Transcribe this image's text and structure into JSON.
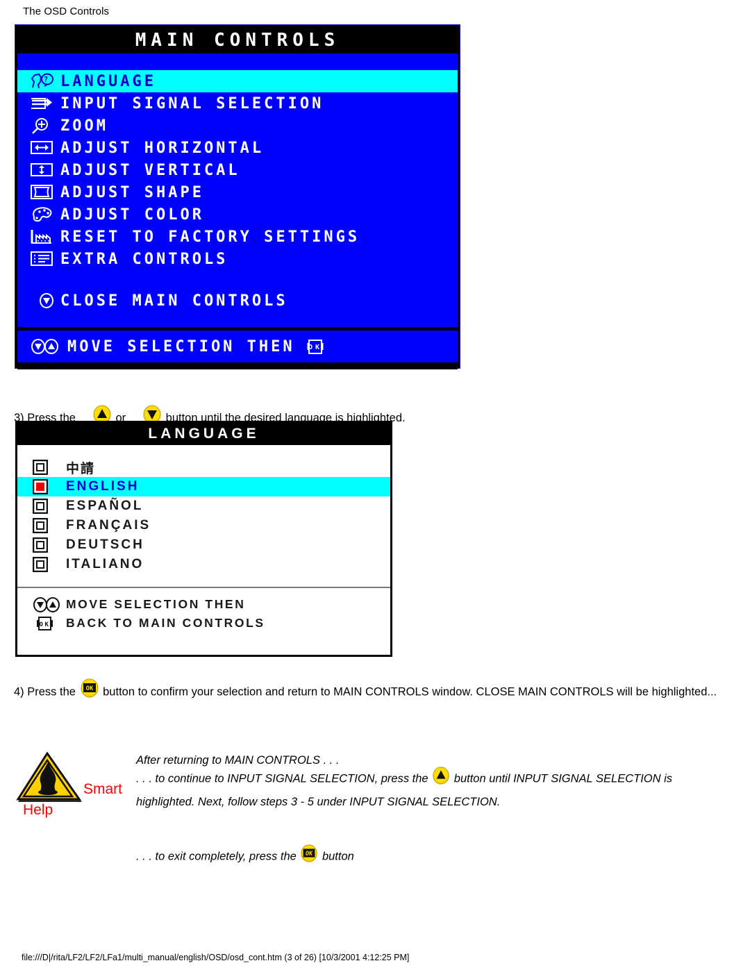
{
  "page_header": "The OSD Controls",
  "main_controls": {
    "title": "MAIN CONTROLS",
    "items": [
      {
        "icon": "language-face-icon",
        "label": "LANGUAGE",
        "highlighted": true
      },
      {
        "icon": "input-arrow-icon",
        "label": "INPUT SIGNAL SELECTION",
        "highlighted": false
      },
      {
        "icon": "magnifier-plus-icon",
        "label": "ZOOM",
        "highlighted": false
      },
      {
        "icon": "horizontal-arrows-icon",
        "label": "ADJUST HORIZONTAL",
        "highlighted": false
      },
      {
        "icon": "vertical-arrows-icon",
        "label": "ADJUST VERTICAL",
        "highlighted": false
      },
      {
        "icon": "shape-frame-icon",
        "label": "ADJUST SHAPE",
        "highlighted": false
      },
      {
        "icon": "palette-icon",
        "label": "ADJUST COLOR",
        "highlighted": false
      },
      {
        "icon": "factory-icon",
        "label": "RESET TO FACTORY SETTINGS",
        "highlighted": false
      },
      {
        "icon": "list-icon",
        "label": "EXTRA CONTROLS",
        "highlighted": false
      }
    ],
    "close_item": {
      "icon": "down-circle-icon",
      "label": "CLOSE MAIN CONTROLS"
    },
    "footer": {
      "icons": "down-up-circle-icon",
      "label": "MOVE SELECTION THEN",
      "ok_icon": "ok-key-icon"
    }
  },
  "step3": {
    "prefix": "3) Press the ",
    "mid": " or ",
    "suffix": " button until the desired language is highlighted.",
    "up_button": "up-arrow-button",
    "down_button": "down-arrow-button"
  },
  "language_menu": {
    "title": "LANGUAGE",
    "options": [
      {
        "label": "中請",
        "cjk": true,
        "highlighted": false
      },
      {
        "label": "ENGLISH",
        "cjk": false,
        "highlighted": true
      },
      {
        "label": "ESPAÑOL",
        "cjk": false,
        "highlighted": false
      },
      {
        "label": "FRANÇAIS",
        "cjk": false,
        "highlighted": false
      },
      {
        "label": "DEUTSCH",
        "cjk": false,
        "highlighted": false
      },
      {
        "label": "ITALIANO",
        "cjk": false,
        "highlighted": false
      }
    ],
    "footer_lines": [
      {
        "icon": "down-up-circle-icon",
        "label": "MOVE SELECTION THEN"
      },
      {
        "icon": "ok-key-icon",
        "label": "BACK TO MAIN CONTROLS"
      }
    ]
  },
  "step4": {
    "prefix": "4) Press the ",
    "suffix": " button to confirm your selection and return to MAIN CONTROLS window. CLOSE MAIN CONTROLS will be highlighted...",
    "ok_button": "ok-button"
  },
  "smart_help": {
    "smart_label": "Smart",
    "help_label": "Help",
    "warning_icon": "warning-triangle-icon",
    "line1": "After returning to MAIN CONTROLS . . .",
    "line2_a": ". . . to continue to INPUT SIGNAL SELECTION, press the ",
    "line2_b": " button until INPUT",
    "line2_c": "SIGNAL SELECTION is highlighted. Next, follow steps 3 - 5 under INPUT SIGNAL",
    "line2_d": "SELECTION.",
    "line3_a": ". . . to exit completely, press the ",
    "line3_b": " button"
  },
  "footer": "file:///D|/rita/LF2/LF2/LFa1/multi_manual/english/OSD/osd_cont.htm (3 of 26) [10/3/2001 4:12:25 PM]",
  "colors": {
    "osd_blue": "#0000ff",
    "osd_highlight": "#00ffff",
    "osd_black": "#000000",
    "accent_red": "#ff0000",
    "button_yellow": "#f2cc00"
  }
}
